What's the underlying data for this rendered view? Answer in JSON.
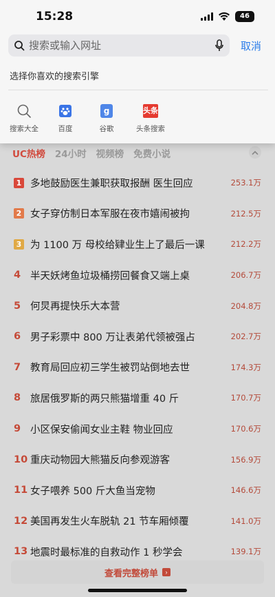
{
  "status": {
    "time": "15:28",
    "battery": "46"
  },
  "search": {
    "placeholder": "搜索或输入网址",
    "cancel": "取消"
  },
  "engines": {
    "title": "选择你喜欢的搜索引擎",
    "items": [
      {
        "label": "搜索大全",
        "icon": "search-icon"
      },
      {
        "label": "百度",
        "icon": "baidu-paw-icon"
      },
      {
        "label": "谷歌",
        "icon": "google-icon",
        "glyph": "g"
      },
      {
        "label": "头条搜索",
        "icon": "toutiao-icon",
        "glyph": "头条"
      }
    ]
  },
  "tabs": [
    "UC热榜",
    "24小时",
    "视频榜",
    "免费小说"
  ],
  "hot_list": [
    {
      "rank": "1",
      "title": "多地鼓励医生兼职获取报酬 医生回应",
      "heat": "253.1万"
    },
    {
      "rank": "2",
      "title": "女子穿仿制日本军服在夜市嬉闹被拘",
      "heat": "212.5万"
    },
    {
      "rank": "3",
      "title": "为 1100 万 母校给肄业生上了最后一课",
      "heat": "212.2万"
    },
    {
      "rank": "4",
      "title": "半天妖烤鱼垃圾桶捞回餐食又端上桌",
      "heat": "206.7万"
    },
    {
      "rank": "5",
      "title": "何炅再提快乐大本营",
      "heat": "204.8万"
    },
    {
      "rank": "6",
      "title": "男子彩票中 800 万让表弟代领被强占",
      "heat": "202.7万"
    },
    {
      "rank": "7",
      "title": "教育局回应初三学生被罚站倒地去世",
      "heat": "174.3万"
    },
    {
      "rank": "8",
      "title": "旅居俄罗斯的两只熊猫增重 40 斤",
      "heat": "170.7万"
    },
    {
      "rank": "9",
      "title": "小区保安偷闻女业主鞋 物业回应",
      "heat": "170.6万"
    },
    {
      "rank": "10",
      "title": "重庆动物园大熊猫反向参观游客",
      "heat": "156.9万"
    },
    {
      "rank": "11",
      "title": "女子喂养 500 斤大鱼当宠物",
      "heat": "146.6万"
    },
    {
      "rank": "12",
      "title": "美国再发生火车脱轨 21 节车厢倾覆",
      "heat": "141.0万"
    },
    {
      "rank": "13",
      "title": "地震时最标准的自救动作 1 秒学会",
      "heat": "139.1万"
    }
  ],
  "more_label": "查看完整榜单",
  "colors": {
    "accent": "#d24b3e",
    "link": "#2b7de9",
    "badge1": "#d9483a",
    "badge2": "#e27a4a",
    "badge3": "#e0a945"
  }
}
